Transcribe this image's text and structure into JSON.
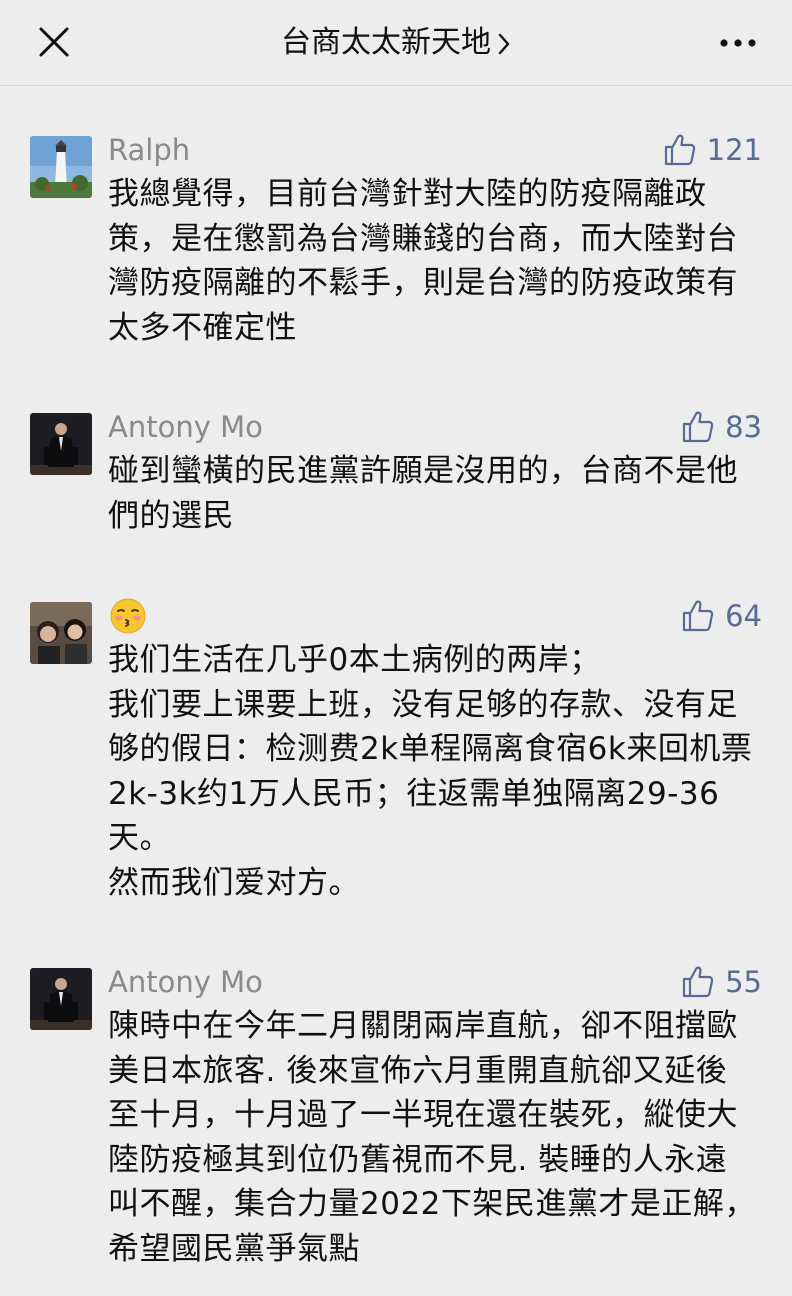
{
  "header": {
    "title": "台商太太新天地",
    "close_icon": "close-icon",
    "chevron_icon": "chevron-right-icon",
    "more_icon": "more-dots-icon"
  },
  "colors": {
    "background": "#ededed",
    "name_gray": "#8a8a8a",
    "like_blue": "#576b95",
    "text": "#111111"
  },
  "comments": [
    {
      "name": "Ralph",
      "likes": "121",
      "text": "我總覺得，目前台灣針對大陸的防疫隔離政策，是在懲罰為台灣賺錢的台商，而大陸對台灣防疫隔離的不鬆手，則是台灣的防疫政策有太多不確定性"
    },
    {
      "name": "Antony Mo",
      "likes": "83",
      "text": "碰到蠻橫的民進黨許願是沒用的，台商不是他們的選民"
    },
    {
      "name": "😚",
      "likes": "64",
      "text": "我们生活在几乎0本土病例的两岸；\n我们要上课要上班，没有足够的存款、没有足够的假日：检测费2k单程隔离食宿6k来回机票2k-3k约1万人民币；往返需单独隔离29-36天。\n然而我们爱对方。"
    },
    {
      "name": "Antony Mo",
      "likes": "55",
      "text": "陳時中在今年二月關閉兩岸直航，卻不阻擋歐美日本旅客. 後來宣佈六月重開直航卻又延後至十月，十月過了一半現在還在裝死，縱使大陸防疫極其到位仍舊視而不見. 裝睡的人永遠叫不醒，集合力量2022下架民進黨才是正解，希望國民黨爭氣點"
    }
  ]
}
